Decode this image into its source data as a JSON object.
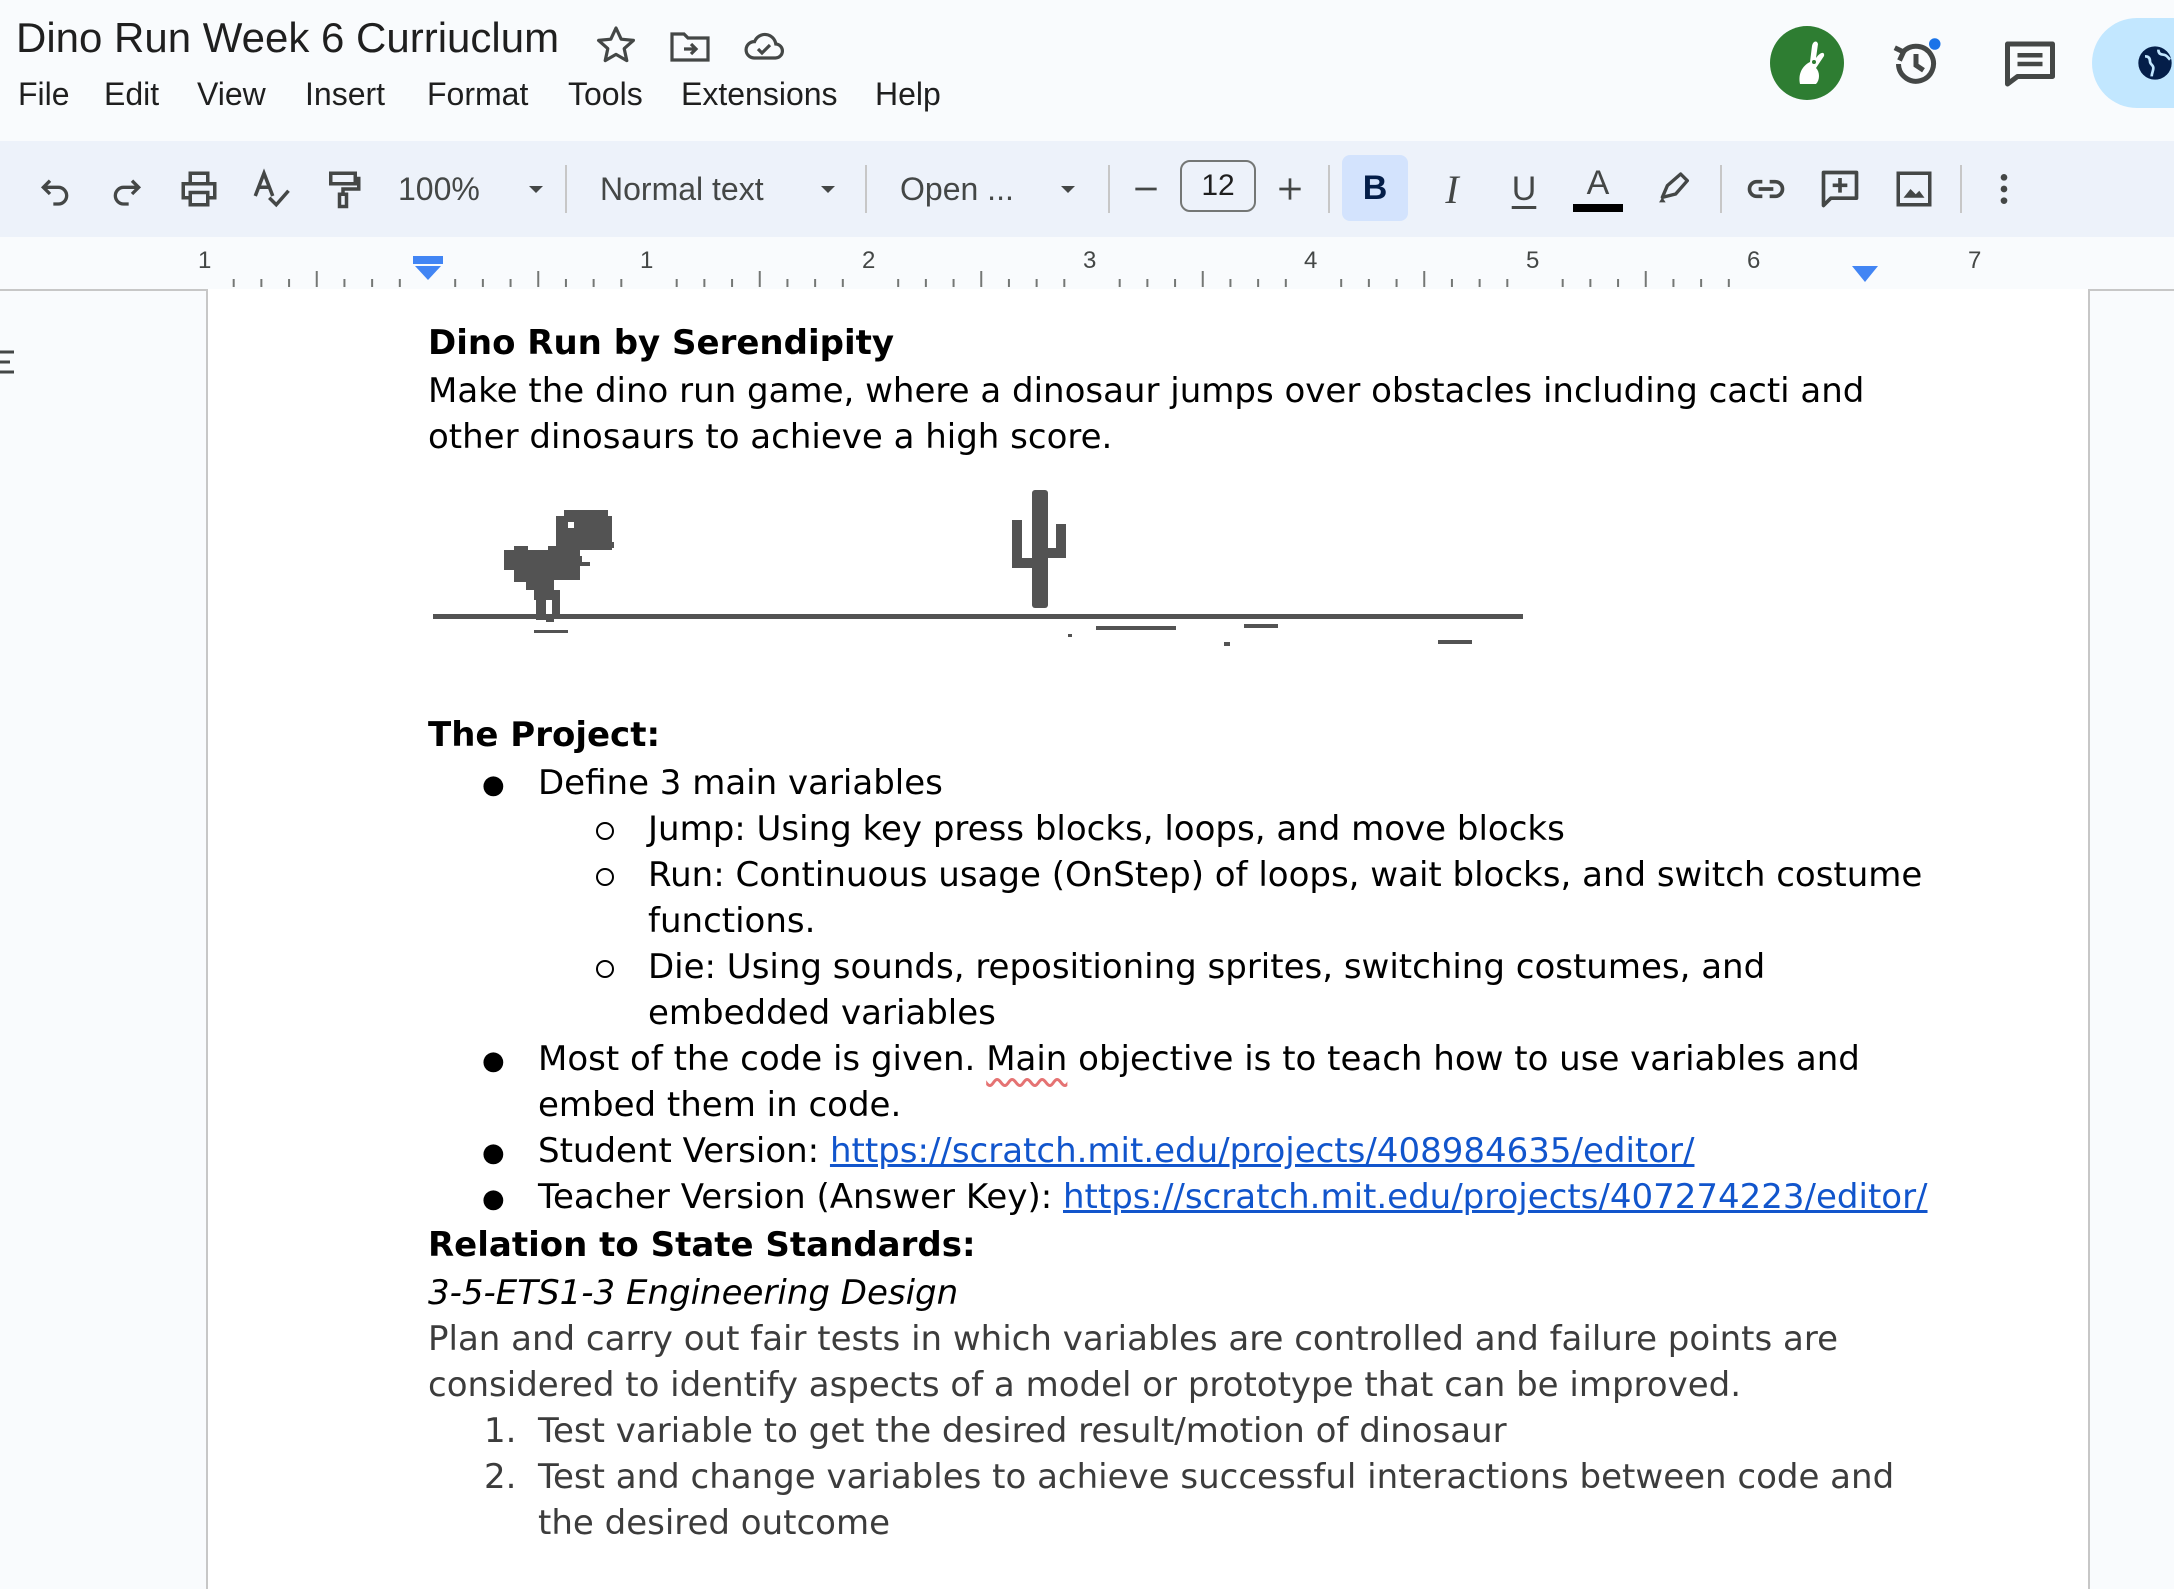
{
  "doc": {
    "title": "Dino Run Week 6 Curriuclum"
  },
  "menu": [
    "File",
    "Edit",
    "View",
    "Insert",
    "Format",
    "Tools",
    "Extensions",
    "Help"
  ],
  "toolbar": {
    "zoom": "100%",
    "style": "Normal text",
    "font": "Open ...",
    "font_size": "12",
    "bold": "B",
    "italic": "I",
    "underline": "U",
    "text_color": "A"
  },
  "ruler": {
    "numbers": [
      "1",
      "1",
      "2",
      "3",
      "4",
      "5",
      "6",
      "7"
    ]
  },
  "content": {
    "heading": "Dino Run by Serendipity",
    "intro_line1": "Make the dino run game, where a dinosaur jumps over obstacles including cacti and",
    "intro_line2": "other dinosaurs to achieve a high score.",
    "project_heading": "The Project:",
    "bullet1": "Define 3 main variables",
    "sub1": "Jump: Using key press blocks, loops, and move blocks",
    "sub2_line1": "Run: Continuous usage (OnStep) of loops, wait blocks, and switch costume",
    "sub2_line2": "functions.",
    "sub3_line1": "Die: Using sounds, repositioning sprites, switching costumes, and",
    "sub3_line2": "embedded variables",
    "bullet2_pre": "Most of the code is given. ",
    "bullet2_spell": "Main",
    "bullet2_post": " objective is to teach how to use variables and",
    "bullet2_line2": "embed them in code.",
    "bullet3_label": "Student Version: ",
    "bullet3_link": "https://scratch.mit.edu/projects/408984635/editor/",
    "bullet4_label": "Teacher Version (Answer Key): ",
    "bullet4_link": "https://scratch.mit.edu/projects/407274223/editor/",
    "standards_heading": "Relation to State Standards:",
    "standard_code": "3-5-ETS1-3 Engineering Design",
    "standard_line1": "Plan and carry out fair tests in which variables are controlled and failure points are",
    "standard_line2": "considered to identify aspects of a model or prototype that can be improved.",
    "num1_marker": "1.",
    "num1": "Test variable to get the desired result/motion of dinosaur",
    "num2_marker": "2.",
    "num2_line1": "Test and change variables to achieve successful interactions between code and",
    "num2_line2": "the desired outcome"
  },
  "colors": {
    "accent": "#1155cc",
    "share_bg": "#c2e7ff",
    "avatar_bg": "#2e7d32",
    "toolbar_bg": "#edf2fa"
  }
}
